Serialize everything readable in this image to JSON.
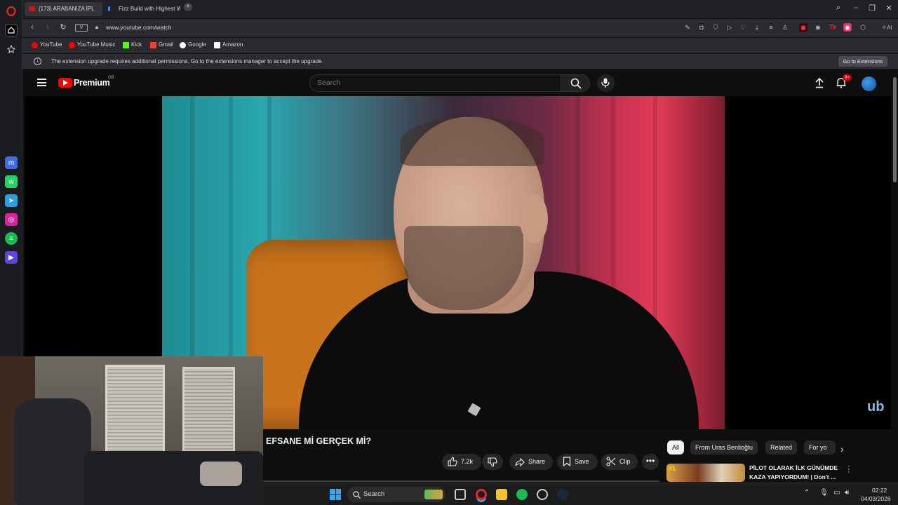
{
  "browser": {
    "tabs": [
      {
        "label": "(173) ARABANIZA İPL",
        "active": true
      },
      {
        "label": "Fizz Build with Highest W",
        "active": false
      }
    ],
    "new_tab_label": "+",
    "address": "www.youtube.com/watch",
    "address_badge": "V",
    "bookmarks": [
      {
        "label": "YouTube",
        "color": "#ff0000"
      },
      {
        "label": "YouTube Music",
        "color": "#ff0000"
      },
      {
        "label": "Kick",
        "color": "#53fc18"
      },
      {
        "label": "Gmail",
        "color": "#ea4335"
      },
      {
        "label": "Google",
        "color": "#ffffff"
      },
      {
        "label": "Amazon",
        "color": "#ffffff"
      }
    ],
    "notification": {
      "text": "The extension upgrade requires additional permissions. Go to the extensions manager to accept the upgrade.",
      "button": "Go to Extensions"
    },
    "ai_label": "AI"
  },
  "youtube": {
    "logo_text": "Premium",
    "logo_region": "GB",
    "search_placeholder": "Search",
    "notification_count": "9+",
    "video_watermark": "ub",
    "video_title": "EFSANE Mİ GERÇEK Mİ?",
    "like_count": "7.2k",
    "actions": {
      "share": "Share",
      "save": "Save",
      "clip": "Clip"
    },
    "chips": [
      "All",
      "From Uras Benlioğlu",
      "Related",
      "For yo"
    ],
    "recommended": {
      "rank": "#1",
      "title_line1": "PİLOT OLARAK İLK GÜNÜMDE",
      "title_line2": "KAZA YAPIYORDUM! | Don't ..."
    }
  },
  "taskbar": {
    "search_label": "Search",
    "time": "02:22",
    "date": "04/03/2026"
  },
  "colors": {
    "accent_red": "#ff0000",
    "opera_red": "#e8252b",
    "chip_active_bg": "#f1f1f1"
  }
}
